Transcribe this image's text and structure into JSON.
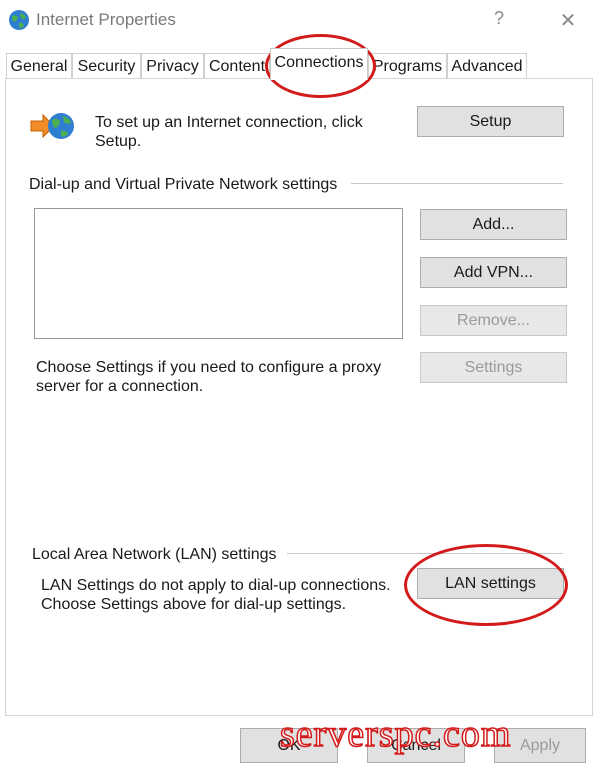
{
  "window": {
    "title": "Internet Properties",
    "help_glyph": "?",
    "close_glyph": "✕"
  },
  "tabs": [
    {
      "label": "General"
    },
    {
      "label": "Security"
    },
    {
      "label": "Privacy"
    },
    {
      "label": "Content"
    },
    {
      "label": "Connections",
      "active": true
    },
    {
      "label": "Programs"
    },
    {
      "label": "Advanced"
    }
  ],
  "setup": {
    "description": "To set up an Internet connection, click Setup.",
    "button": "Setup"
  },
  "dialup": {
    "group_label": "Dial-up and Virtual Private Network settings",
    "add_button": "Add...",
    "add_vpn_button": "Add VPN...",
    "remove_button": "Remove...",
    "settings_button": "Settings",
    "proxy_hint": "Choose Settings if you need to configure a proxy server for a connection."
  },
  "lan": {
    "group_label": "Local Area Network (LAN) settings",
    "description": "LAN Settings do not apply to dial-up connections. Choose Settings above for dial-up settings.",
    "button": "LAN settings"
  },
  "footer": {
    "ok": "OK",
    "cancel": "Cancel",
    "apply": "Apply"
  },
  "watermark": "serverspc.com",
  "colors": {
    "annotation_red": "#d41b1b",
    "button_face": "#e1e1e1",
    "disabled_text": "#9a9a9a"
  }
}
